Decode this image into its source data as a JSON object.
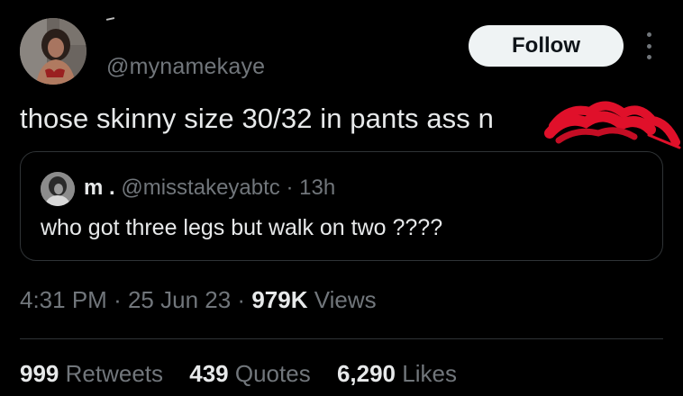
{
  "tweet": {
    "handle": "@mynamekaye",
    "text": "those skinny size 30/32 in pants ass n",
    "follow_label": "Follow",
    "time": "4:31 PM",
    "date": "25 Jun 23",
    "views_count": "979K",
    "views_label": "Views"
  },
  "quote": {
    "name": "m .",
    "handle": "@misstakeyabtc",
    "age": "13h",
    "text": "who got three legs but walk on two ????"
  },
  "stats": {
    "retweets_count": "999",
    "retweets_label": "Retweets",
    "quotes_count": "439",
    "quotes_label": "Quotes",
    "likes_count": "6,290",
    "likes_label": "Likes"
  },
  "colors": {
    "background": "#000000",
    "text_primary": "#e7e9ea",
    "text_secondary": "#71767b",
    "border": "#2f3336",
    "follow_bg": "#eff3f4",
    "scribble": "#e0102a"
  },
  "icons": {
    "more": "more-options-icon"
  }
}
